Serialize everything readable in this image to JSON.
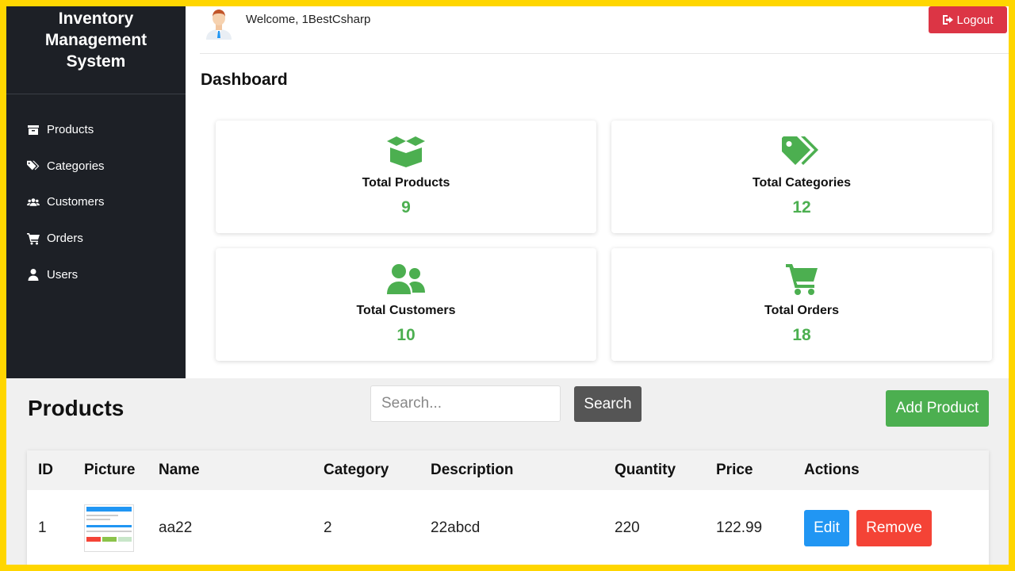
{
  "sidebar": {
    "brand_line1": "Inventory",
    "brand_line2": "Management",
    "brand_line3": "System",
    "items": [
      {
        "label": "Products",
        "icon": "box-icon"
      },
      {
        "label": "Categories",
        "icon": "tags-icon"
      },
      {
        "label": "Customers",
        "icon": "users-icon"
      },
      {
        "label": "Orders",
        "icon": "cart-icon"
      },
      {
        "label": "Users",
        "icon": "user-icon"
      }
    ]
  },
  "header": {
    "welcome": "Welcome, 1BestCsharp",
    "logout_label": "Logout"
  },
  "dashboard": {
    "title": "Dashboard",
    "cards": [
      {
        "label": "Total Products",
        "value": "9",
        "icon": "box-open-icon"
      },
      {
        "label": "Total Categories",
        "value": "12",
        "icon": "tags-icon"
      },
      {
        "label": "Total Customers",
        "value": "10",
        "icon": "users-icon"
      },
      {
        "label": "Total Orders",
        "value": "18",
        "icon": "cart-icon"
      }
    ]
  },
  "products": {
    "title": "Products",
    "search_placeholder": "Search...",
    "search_label": "Search",
    "add_label": "Add Product",
    "columns": [
      "ID",
      "Picture",
      "Name",
      "Category",
      "Description",
      "Quantity",
      "Price",
      "Actions"
    ],
    "rows": [
      {
        "id": "1",
        "name": "aa22",
        "category": "2",
        "description": "22abcd",
        "quantity": "220",
        "price": "122.99",
        "edit_label": "Edit",
        "remove_label": "Remove"
      }
    ]
  },
  "colors": {
    "sidebar_bg": "#1d2026",
    "accent_green": "#4caf50",
    "logout_red": "#dc3545",
    "edit_blue": "#2196f3",
    "remove_red": "#f44336",
    "frame_yellow": "#ffd600"
  }
}
